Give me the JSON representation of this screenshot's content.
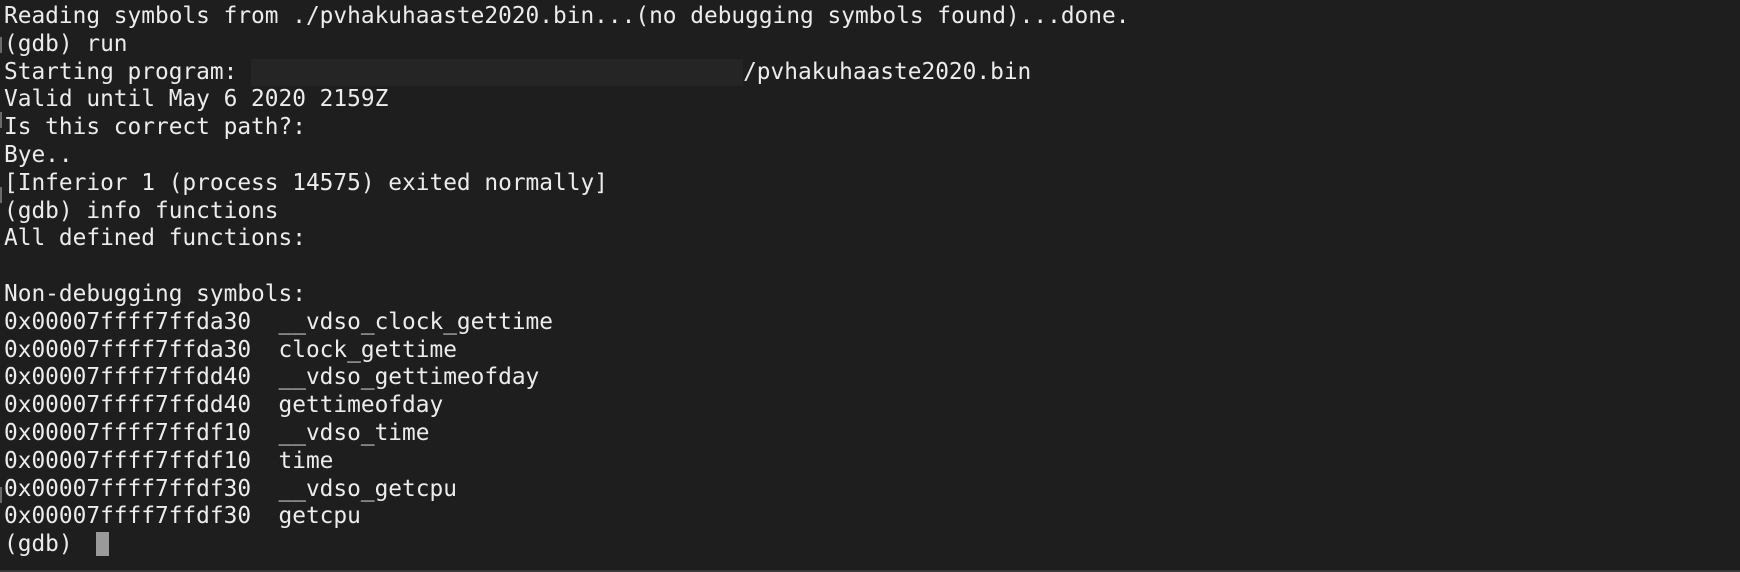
{
  "terminal": {
    "lines": [
      "Reading symbols from ./pvhakuhaaste2020.bin...(no debugging symbols found)...done.",
      "(gdb) run",
      "Starting program: ",
      "Valid until May 6 2020 2159Z",
      "Is this correct path?:",
      "Bye..",
      "[Inferior 1 (process 14575) exited normally]",
      "(gdb) info functions",
      "All defined functions:",
      "",
      "Non-debugging symbols:",
      "0x00007ffff7ffda30  __vdso_clock_gettime",
      "0x00007ffff7ffda30  clock_gettime",
      "0x00007ffff7ffdd40  __vdso_gettimeofday",
      "0x00007ffff7ffdd40  gettimeofday",
      "0x00007ffff7ffdf10  __vdso_time",
      "0x00007ffff7ffdf10  time",
      "0x00007ffff7ffdf30  __vdso_getcpu",
      "0x00007ffff7ffdf30  getcpu",
      "(gdb) "
    ],
    "program_path_suffix": "/pvhakuhaaste2020.bin"
  }
}
